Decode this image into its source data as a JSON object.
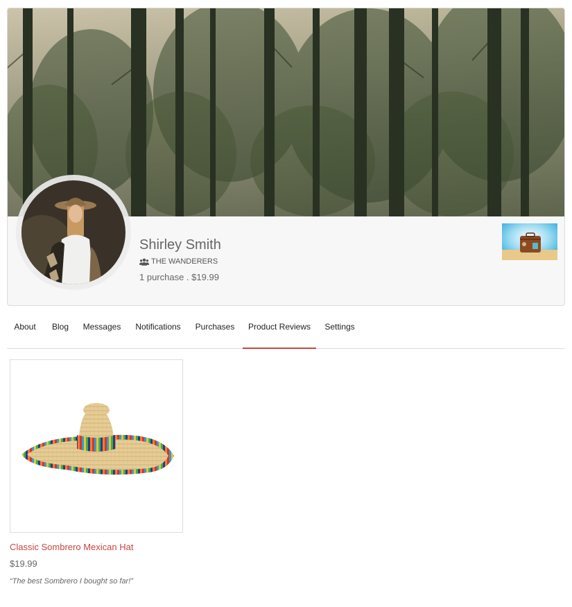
{
  "profile": {
    "name": "Shirley Smith",
    "group_icon": "users-icon",
    "group_name": "THE WANDERERS",
    "purchases": "1 purchase . $19.99"
  },
  "tabs": [
    {
      "label": "About",
      "active": false
    },
    {
      "label": "Blog",
      "active": false
    },
    {
      "label": "Messages",
      "active": false
    },
    {
      "label": "Notifications",
      "active": false
    },
    {
      "label": "Purchases",
      "active": false
    },
    {
      "label": "Product Reviews",
      "active": true
    },
    {
      "label": "Settings",
      "active": false
    }
  ],
  "reviews": [
    {
      "product_name": "Classic Sombrero Mexican Hat",
      "price": "$19.99",
      "review": "“The best Sombrero I bought so far!”"
    }
  ],
  "colors": {
    "accent": "#c7453f",
    "border": "#dcdcdc",
    "card_bg": "#f7f7f7"
  }
}
